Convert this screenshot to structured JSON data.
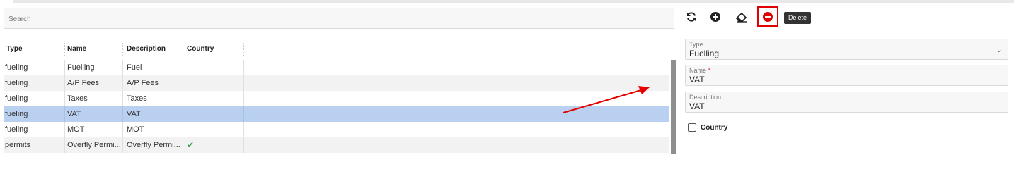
{
  "search": {
    "placeholder": "Search"
  },
  "grid": {
    "columns": [
      "Type",
      "Name",
      "Description",
      "Country"
    ],
    "rows": [
      {
        "type": "fueling",
        "name": "Fuelling",
        "description": "Fuel",
        "country": ""
      },
      {
        "type": "fueling",
        "name": "A/P Fees",
        "description": "A/P Fees",
        "country": ""
      },
      {
        "type": "fueling",
        "name": "Taxes",
        "description": "Taxes",
        "country": ""
      },
      {
        "type": "fueling",
        "name": "VAT",
        "description": "VAT",
        "country": "",
        "selected": true
      },
      {
        "type": "fueling",
        "name": "MOT",
        "description": "MOT",
        "country": ""
      },
      {
        "type": "permits",
        "name": "Overfly Permi...",
        "description": "Overfly Permi...",
        "country": "✔"
      }
    ]
  },
  "toolbar": {
    "refresh_icon": "refresh-icon",
    "add_icon": "add-circle-icon",
    "clear_icon": "eraser-icon",
    "delete_icon": "remove-circle-icon",
    "delete_tooltip": "Delete",
    "highlight_color": "#e00000"
  },
  "form": {
    "type": {
      "label": "Type",
      "value": "Fuelling"
    },
    "name": {
      "label": "Name",
      "required_mark": "*",
      "value": "VAT"
    },
    "description": {
      "label": "Description",
      "value": "VAT"
    },
    "country": {
      "label": "Country",
      "checked": false
    }
  },
  "colors": {
    "selected_row": "#b9d0f0",
    "alt_row": "#f2f2f2",
    "annotation_arrow": "#e60000",
    "checkmark": "#2e9b3d"
  }
}
